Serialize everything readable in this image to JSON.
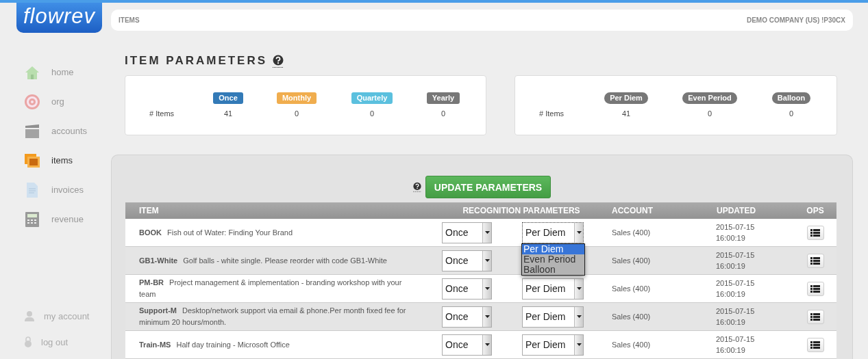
{
  "logo": "flowrev",
  "header": {
    "breadcrumb": "ITEMS",
    "company": "DEMO COMPANY (US) !P30CX"
  },
  "sidebar": {
    "items": [
      {
        "label": "home",
        "kind": "house",
        "selected": false
      },
      {
        "label": "org",
        "kind": "target",
        "selected": false
      },
      {
        "label": "accounts",
        "kind": "clapper",
        "selected": false
      },
      {
        "label": "items",
        "kind": "photos",
        "selected": true
      },
      {
        "label": "invoices",
        "kind": "document",
        "selected": false
      },
      {
        "label": "revenue",
        "kind": "calculator",
        "selected": false
      }
    ],
    "account_links": [
      {
        "label": "my account",
        "kind": "person"
      },
      {
        "label": "log out",
        "kind": "lock"
      }
    ]
  },
  "title": "ITEM PARAMETERS",
  "summary_cards": [
    {
      "row_label": "# Items",
      "kind": "square",
      "columns": [
        {
          "badge": "Once",
          "color": "#337ab7",
          "count": "41"
        },
        {
          "badge": "Monthly",
          "color": "#f0ad4e",
          "count": "0"
        },
        {
          "badge": "Quartely",
          "color": "#5bc0de",
          "count": "0"
        },
        {
          "badge": "Yearly",
          "color": "#777777",
          "count": "0"
        }
      ]
    },
    {
      "row_label": "# Items",
      "kind": "pill",
      "columns": [
        {
          "badge": "Per Diem",
          "color": "#777777",
          "count": "41"
        },
        {
          "badge": "Even Period",
          "color": "#777777",
          "count": "0"
        },
        {
          "badge": "Balloon",
          "color": "#777777",
          "count": "0"
        }
      ]
    }
  ],
  "update_button": "UPDATE PARAMETERS",
  "table": {
    "columns": [
      "ITEM",
      "RECOGNITION PARAMETERS",
      "ACCOUNT",
      "UPDATED",
      "OPS"
    ],
    "rows": [
      {
        "code": "BOOK",
        "description": "Fish out of Water: Finding Your Brand",
        "recognition": "Once",
        "schedule": "Per Diem",
        "account": "Sales (400)",
        "updated": "2015-07-15 16:00:19",
        "schedule_menu": [
          {
            "label": "Per Diem",
            "selected": true
          },
          {
            "label": "Even Period",
            "selected": false
          },
          {
            "label": "Balloon",
            "selected": false
          }
        ]
      },
      {
        "code": "GB1-White",
        "description": "Golf balls - white single. Please reorder with code GB1-White",
        "recognition": "Once",
        "account": "Sales (400)",
        "updated": "2015-07-15 16:00:19"
      },
      {
        "code": "PM-BR",
        "description": "Project management & implementation - branding workshop with your team",
        "recognition": "Once",
        "schedule": "Per Diem",
        "account": "Sales (400)",
        "updated": "2015-07-15 16:00:19"
      },
      {
        "code": "Support-M",
        "description": "Desktop/network support via email & phone.Per month fixed fee for minimum 20 hours/month.",
        "recognition": "Once",
        "schedule": "Per Diem",
        "account": "Sales (400)",
        "updated": "2015-07-15 16:00:19"
      },
      {
        "code": "Train-MS",
        "description": "Half day training - Microsoft Office",
        "recognition": "Once",
        "schedule": "Per Diem",
        "account": "Sales (400)",
        "updated": "2015-07-15 16:00:19"
      }
    ]
  }
}
